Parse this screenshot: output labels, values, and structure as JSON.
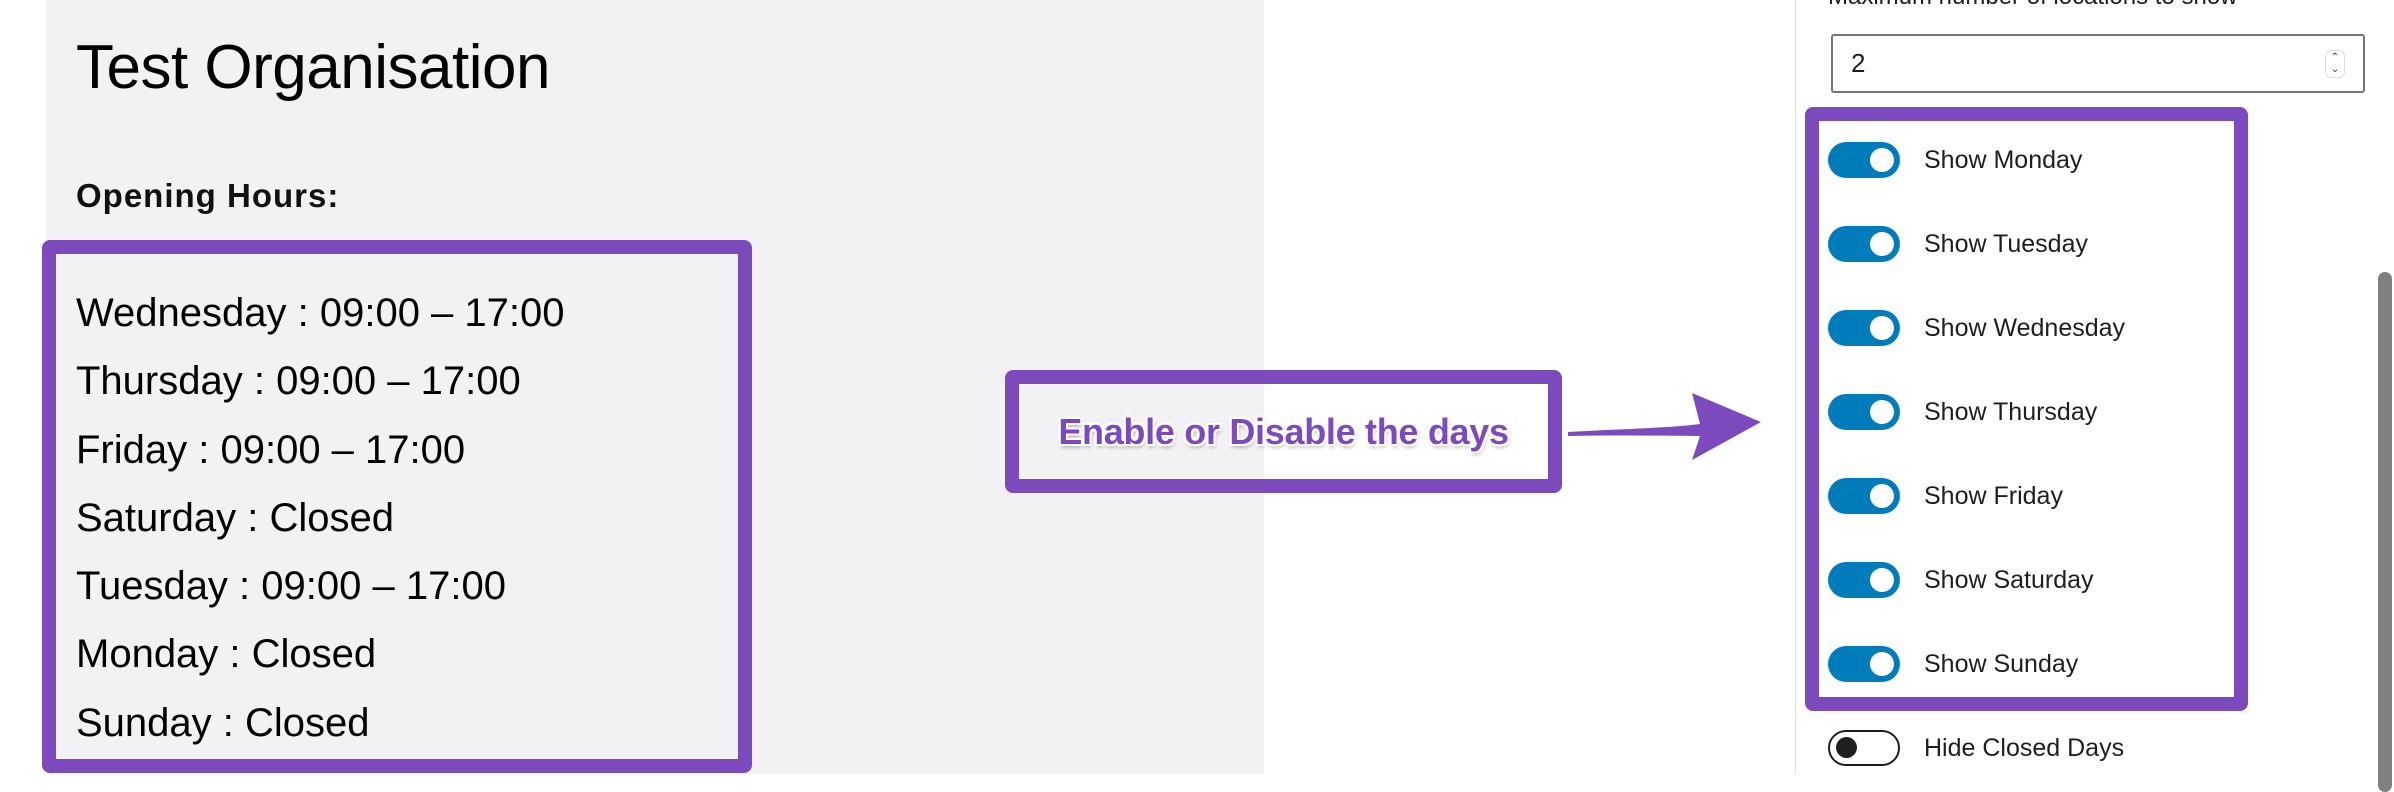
{
  "preview": {
    "title": "Test Organisation",
    "hours_heading": "Opening Hours:",
    "hours": [
      "Wednesday : 09:00 – 17:00",
      "Thursday : 09:00 – 17:00",
      "Friday : 09:00 – 17:00",
      "Saturday : Closed",
      "Tuesday : 09:00 – 17:00",
      "Monday : Closed",
      "Sunday : Closed"
    ]
  },
  "annotation": {
    "callout_text": "Enable or Disable the days",
    "highlight_color": "#7b4bbd",
    "arrow_icon": "arrow-right-icon"
  },
  "settings": {
    "max_locations_label": "Maximum number of locations to show",
    "max_locations_value": "2",
    "spinner_up": "⌃",
    "spinner_down": "⌄",
    "toggle_color": "#007cba",
    "toggles": [
      {
        "label": "Show Monday",
        "checked": true
      },
      {
        "label": "Show Tuesday",
        "checked": true
      },
      {
        "label": "Show Wednesday",
        "checked": true
      },
      {
        "label": "Show Thursday",
        "checked": true
      },
      {
        "label": "Show Friday",
        "checked": true
      },
      {
        "label": "Show Saturday",
        "checked": true
      },
      {
        "label": "Show Sunday",
        "checked": true
      },
      {
        "label": "Hide Closed Days",
        "checked": false
      }
    ]
  }
}
